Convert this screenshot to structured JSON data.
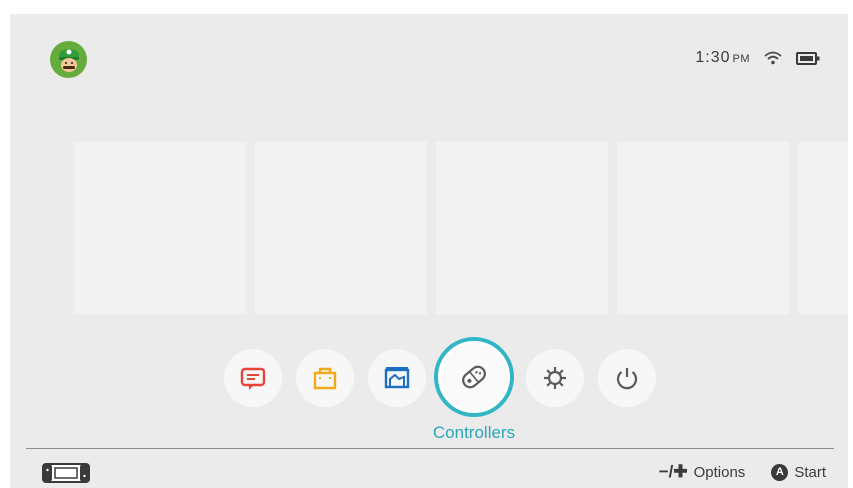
{
  "header": {
    "avatar_icon": "luigi-avatar-icon",
    "time": "1:30",
    "ampm": "PM",
    "wifi_icon": "wifi-icon",
    "battery_icon": "battery-icon"
  },
  "tiles": {
    "count": 5
  },
  "dock": {
    "items": [
      {
        "icon": "news-icon",
        "color": "#e8443a"
      },
      {
        "icon": "eshop-bag-icon",
        "color": "#f0a81c"
      },
      {
        "icon": "album-icon",
        "color": "#1d6fc2"
      },
      {
        "icon": "controllers-icon",
        "color": "#5a5a5a"
      },
      {
        "icon": "settings-icon",
        "color": "#5a5a5a"
      },
      {
        "icon": "power-icon",
        "color": "#5a5a5a"
      }
    ],
    "selected_label": "Controllers"
  },
  "footer": {
    "console_icon": "console-handheld-icon",
    "options_symbol": "−/✚",
    "options_label": "Options",
    "a_button": "A",
    "start_label": "Start"
  },
  "colors": {
    "accent": "#32b6c6",
    "background": "#ebebeb"
  }
}
